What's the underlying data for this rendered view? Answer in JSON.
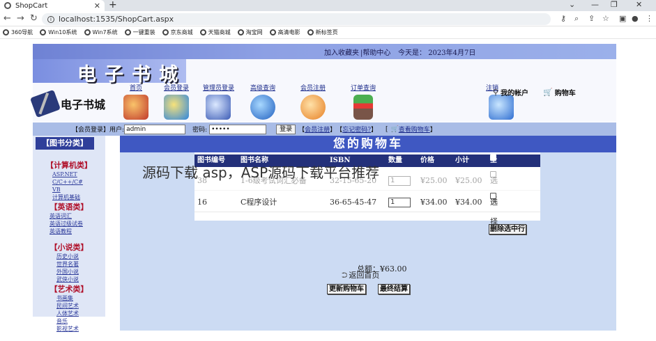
{
  "browser": {
    "tab_title": "ShopCart",
    "url": "localhost:1535/ShopCart.aspx",
    "bookmarks": [
      "360导航",
      "Win10系统",
      "Win7系统",
      "一键重装",
      "京东商城",
      "天猫商城",
      "淘宝网",
      "高清电影",
      "新标签页"
    ]
  },
  "site": {
    "top_links": [
      "加入收藏夹",
      "帮助中心"
    ],
    "date_label": "今天是：",
    "date_value": "2023年4月7日",
    "title_art": "电子书城",
    "logo_text": "电子书城",
    "nav": [
      "首页",
      "会员登录",
      "管理员登录",
      "高级查询",
      "会员注册",
      "订单查询",
      "注销"
    ],
    "my_account": "我的帐户",
    "cart_link": "购物车"
  },
  "login": {
    "section_label": "【会员登录】",
    "user_label": "用户:",
    "user_value": "admin",
    "pwd_label": "密码:",
    "pwd_value": "•••••",
    "login_button": "登录",
    "register_link": "会员注册",
    "forgot_link": "忘记密码?",
    "view_cart_link": "查看购物车",
    "open_bracket": "[",
    "close_bracket": "]",
    "open_bracket2": "【",
    "close_bracket2": "】"
  },
  "sidebar": {
    "header": "【图书分类】",
    "categories": [
      {
        "name": "【计算机类】",
        "items": [
          "ASP.NET",
          "C/C++/C#",
          "VB",
          "计算机基础"
        ]
      },
      {
        "name": "【英语类】",
        "items": [
          "英语词汇",
          "英语过级试卷",
          "英语教程"
        ]
      },
      {
        "name": "【小说类】",
        "items": [
          "历史小说",
          "世界名著",
          "外国小说",
          "武侠小说"
        ]
      },
      {
        "name": "【艺术类】",
        "items": [
          "书画集",
          "民间艺术",
          "人体艺术",
          "音乐",
          "影视艺术"
        ]
      }
    ]
  },
  "cart": {
    "title": "您的购物车",
    "columns": [
      "图书编号",
      "图书名称",
      "ISBN",
      "数量",
      "价格",
      "小计",
      "全选"
    ],
    "rows": [
      {
        "id": "38",
        "name": "1-6级考试词汇必备",
        "isbn": "32-15-65-20",
        "qty": "1",
        "price": "¥25.00",
        "subtotal": "¥25.00",
        "select": "选择"
      },
      {
        "id": "16",
        "name": "C程序设计",
        "isbn": "36-65-45-47",
        "qty": "1",
        "price": "¥34.00",
        "subtotal": "¥34.00",
        "select": "选择"
      }
    ],
    "delete_button": "删除选中行",
    "total_label": "总额：",
    "total_value": "¥63.00",
    "back_link": "返回首页",
    "update_button": "更新购物车",
    "checkout_button": "最终结算"
  },
  "overlay_text": "源码下载 asp，ASP源码下载平台推荐"
}
